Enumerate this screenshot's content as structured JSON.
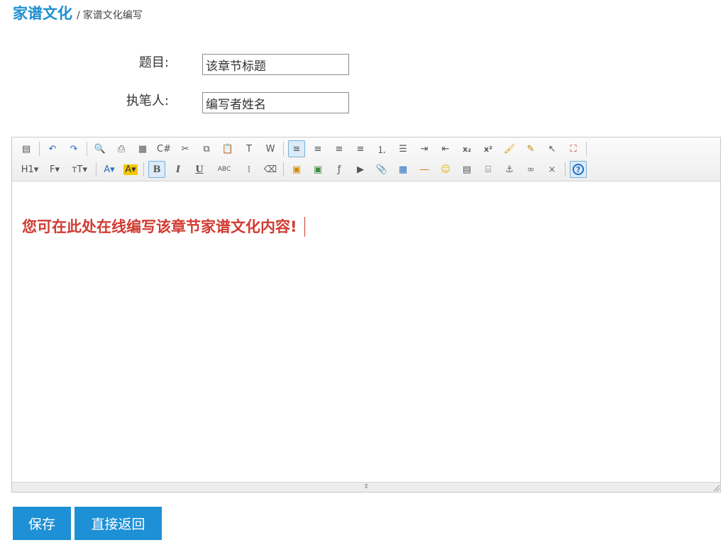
{
  "breadcrumb": {
    "main": "家谱文化",
    "separator": "/",
    "sub": "家谱文化编写"
  },
  "form": {
    "title_label": "题目:",
    "title_value": "该章节标题",
    "author_label": "执笔人:",
    "author_value": "编写者姓名"
  },
  "editor": {
    "content": "您可在此处在线编写该章节家谱文化内容!",
    "toolbar_row1": [
      {
        "name": "source-icon",
        "glyph": "▤"
      },
      {
        "name": "undo-icon",
        "glyph": "↶"
      },
      {
        "name": "redo-icon",
        "glyph": "↷"
      },
      {
        "name": "preview-icon",
        "glyph": "🔍"
      },
      {
        "name": "print-icon",
        "glyph": "⎙"
      },
      {
        "name": "template-icon",
        "glyph": "▦"
      },
      {
        "name": "code-icon",
        "glyph": "C#"
      },
      {
        "name": "cut-icon",
        "glyph": "✂"
      },
      {
        "name": "copy-icon",
        "glyph": "⧉"
      },
      {
        "name": "paste-icon",
        "glyph": "📋"
      },
      {
        "name": "paste-text-icon",
        "glyph": "T"
      },
      {
        "name": "paste-word-icon",
        "glyph": "W"
      },
      {
        "name": "align-left-icon",
        "glyph": "≡"
      },
      {
        "name": "align-center-icon",
        "glyph": "≡"
      },
      {
        "name": "align-right-icon",
        "glyph": "≡"
      },
      {
        "name": "align-justify-icon",
        "glyph": "≡"
      },
      {
        "name": "ordered-list-icon",
        "glyph": "⒈"
      },
      {
        "name": "unordered-list-icon",
        "glyph": "☰"
      },
      {
        "name": "indent-icon",
        "glyph": "⇥"
      },
      {
        "name": "outdent-icon",
        "glyph": "⇤"
      },
      {
        "name": "subscript-icon",
        "glyph": "x₂"
      },
      {
        "name": "superscript-icon",
        "glyph": "x²"
      },
      {
        "name": "clear-format-icon",
        "glyph": "🖌"
      },
      {
        "name": "quick-format-icon",
        "glyph": "✎"
      },
      {
        "name": "select-all-icon",
        "glyph": "↖"
      },
      {
        "name": "fullscreen-icon",
        "glyph": "⛶"
      }
    ],
    "toolbar_row2": [
      {
        "name": "heading-icon",
        "glyph": "H1▾"
      },
      {
        "name": "font-family-icon",
        "glyph": "F▾"
      },
      {
        "name": "font-size-icon",
        "glyph": "тT▾"
      },
      {
        "name": "text-color-icon",
        "glyph": "A▾"
      },
      {
        "name": "background-color-icon",
        "glyph": "A▾"
      },
      {
        "name": "bold-icon",
        "glyph": "B"
      },
      {
        "name": "italic-icon",
        "glyph": "I"
      },
      {
        "name": "underline-icon",
        "glyph": "U"
      },
      {
        "name": "strikethrough-icon",
        "glyph": "ABC"
      },
      {
        "name": "line-height-icon",
        "glyph": "⁞"
      },
      {
        "name": "eraser-icon",
        "glyph": "⌫"
      },
      {
        "name": "image-icon",
        "glyph": "▣"
      },
      {
        "name": "multi-image-icon",
        "glyph": "▣"
      },
      {
        "name": "flash-icon",
        "glyph": "ƒ"
      },
      {
        "name": "media-icon",
        "glyph": "▶"
      },
      {
        "name": "attachment-icon",
        "glyph": "📎"
      },
      {
        "name": "table-icon",
        "glyph": "▦"
      },
      {
        "name": "hr-icon",
        "glyph": "―"
      },
      {
        "name": "emoticon-icon",
        "glyph": "☺"
      },
      {
        "name": "map-icon",
        "glyph": "▤"
      },
      {
        "name": "pagebreak-icon",
        "glyph": "⌸"
      },
      {
        "name": "anchor-icon",
        "glyph": "⚓"
      },
      {
        "name": "link-icon",
        "glyph": "∞"
      },
      {
        "name": "unlink-icon",
        "glyph": "⨯"
      },
      {
        "name": "help-icon",
        "glyph": "?"
      }
    ]
  },
  "buttons": {
    "save": "保存",
    "back": "直接返回"
  },
  "colors": {
    "accent": "#1e90d5",
    "content_text": "#d13b32"
  }
}
